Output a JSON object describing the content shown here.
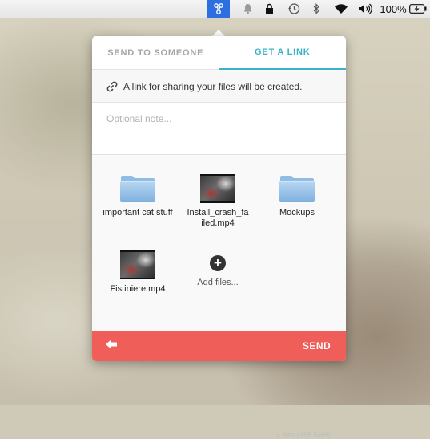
{
  "menubar": {
    "app_icon": "droplr-app-icon",
    "icons": [
      "bell-icon",
      "lock-icon",
      "time-machine-icon",
      "bluetooth-icon",
      "wifi-icon",
      "volume-icon"
    ],
    "battery_percent": "100%",
    "battery_icon": "battery-charging-icon"
  },
  "popover": {
    "tabs": [
      {
        "label": "SEND TO SOMEONE",
        "active": false
      },
      {
        "label": "GET A LINK",
        "active": true
      }
    ],
    "info": {
      "icon": "link-icon",
      "text": "A link for sharing your files will be created."
    },
    "note": {
      "placeholder": "Optional note..."
    },
    "files": [
      {
        "name": "important cat stuff",
        "type": "folder"
      },
      {
        "name": "Install_crash_failed.mp4",
        "name_line1": "Install_crash_fa",
        "name_line2": "iled.mp4",
        "type": "video"
      },
      {
        "name": "Mockups",
        "type": "folder"
      },
      {
        "name": "Fistiniere.mp4",
        "type": "video"
      }
    ],
    "add_files_label": "Add files...",
    "summary": "4 files (158.5MB)",
    "footer": {
      "back_icon": "back-arrow-icon",
      "send_label": "SEND"
    }
  },
  "colors": {
    "accent": "#3bb3c5",
    "footer": "#f05e5a",
    "menubar_highlight": "#2d6ee0"
  }
}
